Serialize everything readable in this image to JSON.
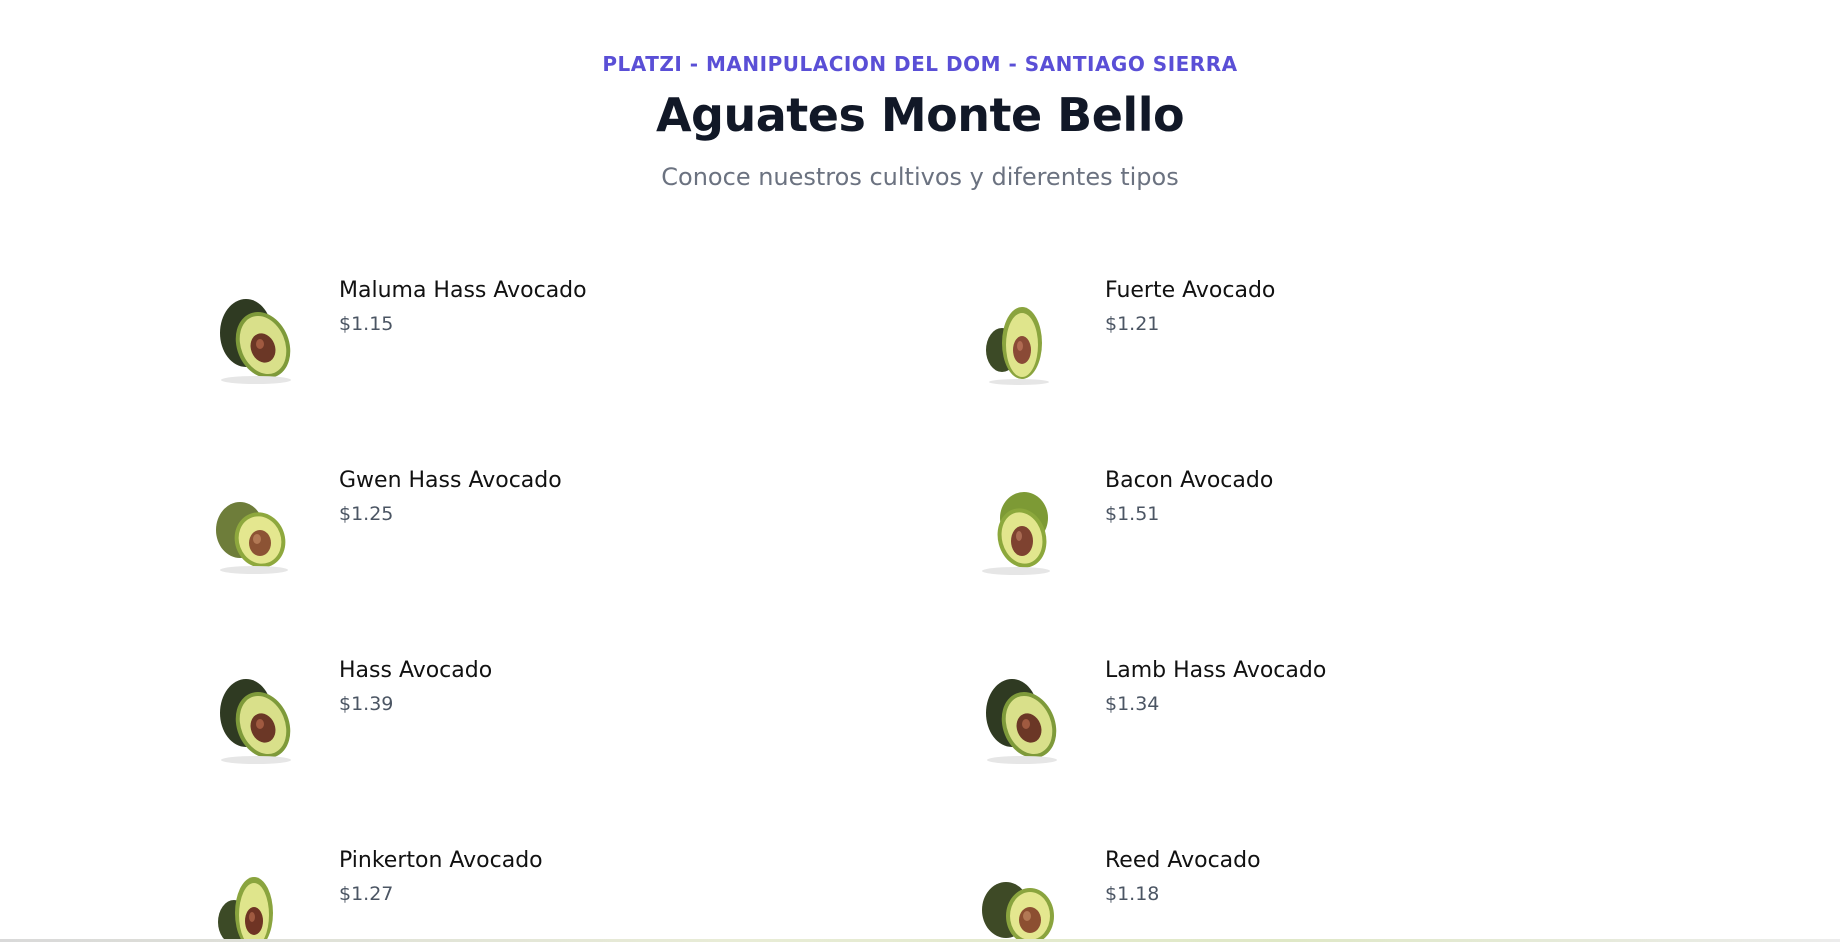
{
  "header": {
    "eyebrow": "PLATZI - MANIPULACION DEL DOM - SANTIAGO SIERRA",
    "title": "Aguates Monte Bello",
    "subtitle": "Conoce nuestros cultivos y diferentes tipos"
  },
  "products": [
    {
      "name": "Maluma Hass Avocado",
      "price": "$1.15",
      "icon": "avocado-half-dark-icon"
    },
    {
      "name": "Fuerte Avocado",
      "price": "$1.21",
      "icon": "avocado-half-upright-icon"
    },
    {
      "name": "Gwen Hass Avocado",
      "price": "$1.25",
      "icon": "avocado-half-green-icon"
    },
    {
      "name": "Bacon Avocado",
      "price": "$1.51",
      "icon": "avocado-half-green-icon"
    },
    {
      "name": "Hass Avocado",
      "price": "$1.39",
      "icon": "avocado-half-dark-icon"
    },
    {
      "name": "Lamb Hass Avocado",
      "price": "$1.34",
      "icon": "avocado-half-dark-icon"
    },
    {
      "name": "Pinkerton Avocado",
      "price": "$1.27",
      "icon": "avocado-half-upright-icon"
    },
    {
      "name": "Reed Avocado",
      "price": "$1.18",
      "icon": "avocado-half-round-icon"
    }
  ],
  "colors": {
    "accent": "#5a4fd6",
    "title": "#111827",
    "subtitle": "#6b7280",
    "price": "#4b5563"
  }
}
